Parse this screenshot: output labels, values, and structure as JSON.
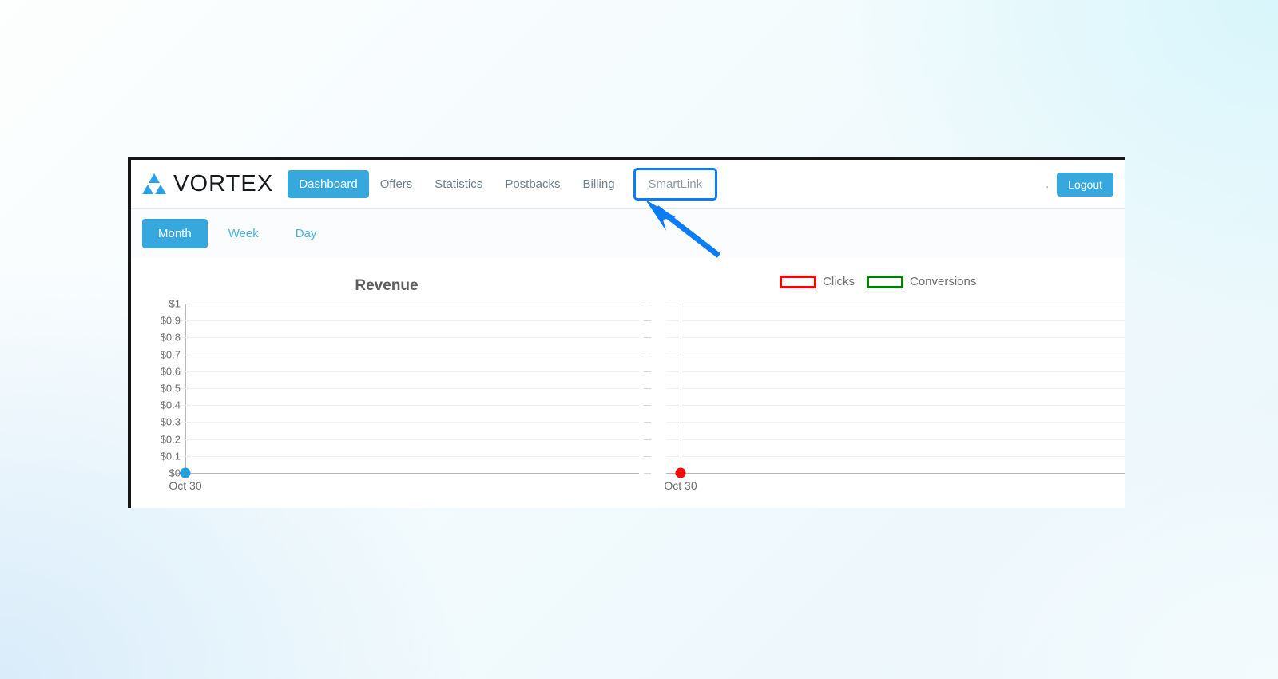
{
  "brand": {
    "name": "VORTEX",
    "logo_icon": "triangle-trio-logo",
    "accent": "#27a2e8"
  },
  "navbar": {
    "links": [
      {
        "label": "Dashboard",
        "state": "active"
      },
      {
        "label": "Offers",
        "state": "default"
      },
      {
        "label": "Statistics",
        "state": "default"
      },
      {
        "label": "Postbacks",
        "state": "default"
      },
      {
        "label": "Billing",
        "state": "default"
      },
      {
        "label": "SmartLink",
        "state": "highlighted"
      }
    ],
    "separator_dot": ".",
    "logout_label": "Logout",
    "accent_color": "#36a8dd",
    "highlight_color": "#0a7cf7"
  },
  "period_tabs": [
    {
      "label": "Month",
      "state": "active"
    },
    {
      "label": "Week",
      "state": "default"
    },
    {
      "label": "Day",
      "state": "default"
    }
  ],
  "legend": {
    "items": [
      {
        "label": "Clicks",
        "color": "#ff0000"
      },
      {
        "label": "Conversions",
        "color": "#008000"
      }
    ]
  },
  "annotation": {
    "arrow_color": "#0a7cf7",
    "arrow_target": "SmartLink",
    "highlight_box_target": "SmartLink"
  },
  "chart_data": [
    {
      "type": "line",
      "title": "Revenue",
      "xlabel": "",
      "ylabel": "",
      "categories": [
        "Oct 30"
      ],
      "x": [
        "Oct 30"
      ],
      "values": [
        0
      ],
      "series": [
        {
          "name": "Revenue",
          "values": [
            0
          ],
          "color": "#1f9fdc"
        }
      ],
      "ylim": [
        0,
        1
      ],
      "ytick_labels": [
        "$1",
        "$0.9",
        "$0.8",
        "$0.7",
        "$0.6",
        "$0.5",
        "$0.4",
        "$0.3",
        "$0.2",
        "$0.1",
        "$0"
      ],
      "ytick_values": [
        1,
        0.9,
        0.8,
        0.7,
        0.6,
        0.5,
        0.4,
        0.3,
        0.2,
        0.1,
        0
      ],
      "xtick_labels": [
        "Oct 30"
      ],
      "grid": true,
      "legend_position": "none"
    },
    {
      "type": "line",
      "title": "",
      "xlabel": "",
      "ylabel": "",
      "categories": [
        "Oct 30"
      ],
      "x": [
        "Oct 30"
      ],
      "values": [
        0
      ],
      "series": [
        {
          "name": "Clicks",
          "values": [
            0
          ],
          "color": "#f00b0b"
        },
        {
          "name": "Conversions",
          "values": [
            0
          ],
          "color": "#008000"
        }
      ],
      "ylim": [
        0,
        1
      ],
      "ytick_labels": [
        "",
        "",
        "",
        "",
        "",
        "",
        "",
        "",
        "",
        "",
        ""
      ],
      "ytick_values": [
        1,
        0.9,
        0.8,
        0.7,
        0.6,
        0.5,
        0.4,
        0.3,
        0.2,
        0.1,
        0
      ],
      "xtick_labels": [
        "Oct 30"
      ],
      "grid": true,
      "legend_position": "top-right"
    }
  ]
}
